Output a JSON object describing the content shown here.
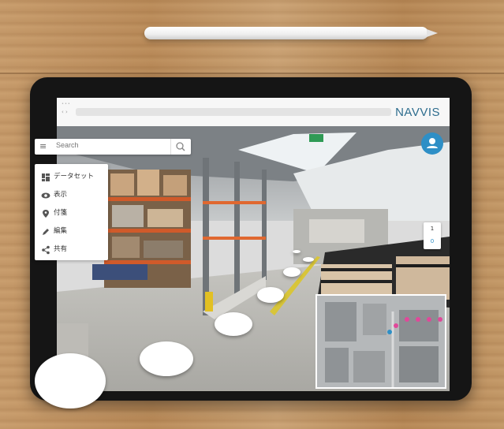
{
  "browser": {
    "window_dots": "•••",
    "nav_arrows": "‹ ›",
    "logo": "NAVVIS"
  },
  "search": {
    "placeholder": "Search"
  },
  "menu": {
    "items": [
      {
        "label": "データセット",
        "icon": "dataset-icon"
      },
      {
        "label": "表示",
        "icon": "eye-icon"
      },
      {
        "label": "付箋",
        "icon": "pin-icon"
      },
      {
        "label": "編集",
        "icon": "pencil-icon"
      },
      {
        "label": "共有",
        "icon": "share-icon"
      }
    ]
  },
  "levels": {
    "top": "1",
    "bottom": "0"
  },
  "colors": {
    "accent": "#2e8fc6",
    "logo": "#2e6d8e",
    "minimap_pin": "#e0489a"
  }
}
